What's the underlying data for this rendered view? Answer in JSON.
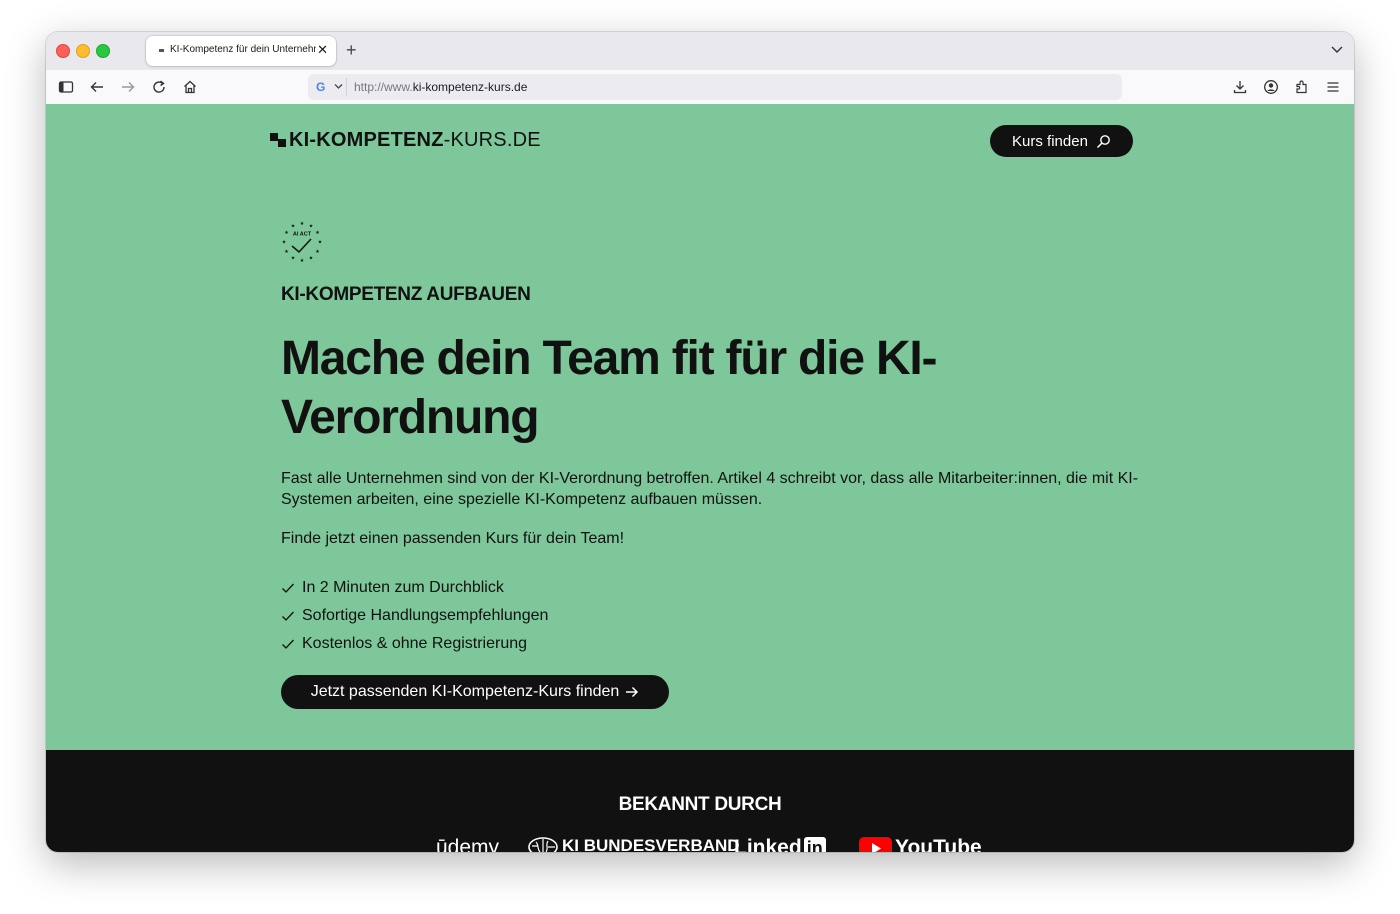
{
  "browser": {
    "tab_title": "KI-Kompetenz für dein Unternehmen",
    "tab_close": "✕",
    "new_tab": "+",
    "search_engine": "G",
    "url_prefix": "http://www.",
    "url_domain": "ki-kompetenz-kurs.de"
  },
  "site": {
    "logo_bold": "KI-KOMPETENZ",
    "logo_thin": "-KURS.DE",
    "nav_button": "Kurs finden",
    "badge_text": "AI ACT"
  },
  "hero": {
    "kicker": "KI-KOMPETENZ AUFBAUEN",
    "headline": "Mache dein Team fit für die KI-Verordnung",
    "lead": "Fast alle Unternehmen sind von der KI-Verordnung betroffen. Artikel 4 schreibt vor, dass alle Mitarbeiter:innen, die mit KI-Systemen arbeiten, eine spezielle KI-Kompetenz aufbauen müssen.",
    "lead2": "Finde jetzt einen passenden Kurs für dein Team!",
    "checklist": [
      "In 2 Minuten zum Durchblick",
      "Sofortige Handlungsempfehlungen",
      "Kostenlos & ohne Registrierung"
    ],
    "cta": "Jetzt passenden KI-Kompetenz-Kurs finden"
  },
  "footer": {
    "known_title": "BEKANNT DURCH",
    "brands": [
      "ūdemy",
      "KI BUNDESVERBAND",
      "Linked",
      "in",
      "YouTube"
    ]
  },
  "colors": {
    "hero_bg": "#7dc79a",
    "dark": "#111111",
    "text_on_dark": "#ffffff"
  }
}
